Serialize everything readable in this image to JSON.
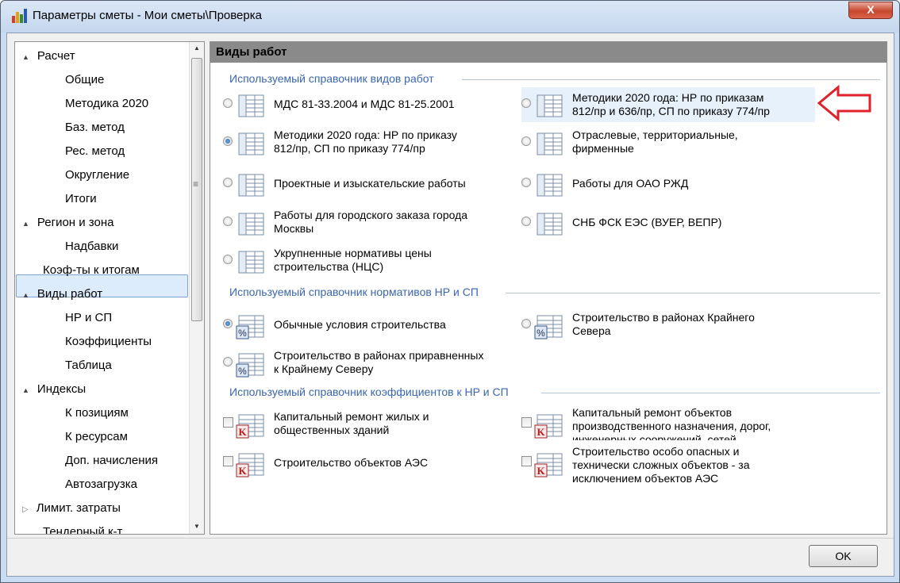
{
  "window": {
    "title": "Параметры сметы - Мои сметы\\Проверка",
    "close_label": "X"
  },
  "nav": {
    "items": [
      {
        "label": "Расчет",
        "expander": "▲"
      },
      {
        "label": "Общие"
      },
      {
        "label": "Методика 2020"
      },
      {
        "label": "Баз. метод"
      },
      {
        "label": "Рес. метод"
      },
      {
        "label": "Округление"
      },
      {
        "label": "Итоги"
      },
      {
        "label": "Регион и зона",
        "expander": "▲"
      },
      {
        "label": "Надбавки"
      },
      {
        "label": "Коэф-ты к итогам"
      },
      {
        "label": "Виды работ",
        "expander": "▲"
      },
      {
        "label": "НР и СП"
      },
      {
        "label": "Коэффициенты"
      },
      {
        "label": "Таблица"
      },
      {
        "label": "Индексы",
        "expander": "▲"
      },
      {
        "label": "К позициям"
      },
      {
        "label": "К ресурсам"
      },
      {
        "label": "Доп. начисления"
      },
      {
        "label": "Автозагрузка"
      },
      {
        "label": "Лимит. затраты",
        "expander": "▷"
      },
      {
        "label": "Тендерный к-т"
      }
    ],
    "scroll_up": "▲",
    "scroll_down": "▼",
    "scroll_grip": "≡"
  },
  "main": {
    "header": "Виды работ",
    "sections": [
      "Используемый справочник видов работ",
      "Используемый справочник нормативов НР и СП",
      "Используемый справочник коэффициентов к НР и СП"
    ],
    "work_types": [
      {
        "label": "МДС 81-33.2004 и МДС 81-25.2001",
        "checked": false
      },
      {
        "label": "Методики 2020 года: НР по приказам\n812/пр и 636/пр, СП по приказу 774/пр",
        "checked": false
      },
      {
        "label": "Методики 2020 года: НР по приказу\n812/пр, СП по приказу 774/пр",
        "checked": true
      },
      {
        "label": "Отраслевые, территориальные,\nфирменные",
        "checked": false
      },
      {
        "label": "Проектные и изыскательские работы",
        "checked": false
      },
      {
        "label": "Работы для ОАО РЖД",
        "checked": false
      },
      {
        "label": "Работы для городского заказа города\nМосквы",
        "checked": false
      },
      {
        "label": "СНБ ФСК ЕЭС (ВУЕР, ВЕПР)",
        "checked": false
      },
      {
        "label": "Укрупненные нормативы цены\nстроительства (НЦС)",
        "checked": false
      }
    ],
    "norms": [
      {
        "label": "Обычные условия строительства",
        "checked": true
      },
      {
        "label": "Строительство в районах Крайнего\nСевера",
        "checked": false
      },
      {
        "label": "Строительство в районах приравненных\nк Крайнему Северу",
        "checked": false
      }
    ],
    "coefficients": [
      {
        "label": "Капитальный ремонт жилых и\nобщественных зданий",
        "checked": false
      },
      {
        "label": "Капитальный ремонт объектов\nпроизводственного назначения, дорог,\nинженерных сооружений, сетей",
        "checked": false
      },
      {
        "label": "Строительство объектов АЭС",
        "checked": false
      },
      {
        "label": "Строительство особо опасных и\nтехнически сложных объектов - за\nисключением объектов АЭС",
        "checked": false
      }
    ],
    "icon_glyph_percent": "%",
    "icon_glyph_k": "K"
  },
  "footer": {
    "ok_label": "OK"
  },
  "colors": {
    "accent": "#3a66b0",
    "header": "#8a8a8a",
    "arrow": "#e0202a",
    "selection": "#dcecfc"
  }
}
